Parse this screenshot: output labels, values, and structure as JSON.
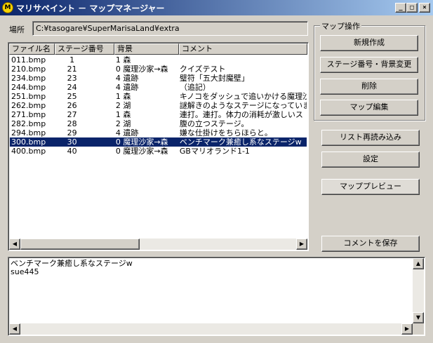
{
  "window": {
    "title": "マリサペイント － マップマネージャー",
    "icon_label": "M",
    "minimize_glyph": "_",
    "maximize_glyph": "□",
    "close_glyph": "×"
  },
  "location": {
    "label": "場所",
    "path": "C:¥tasogare¥SuperMarisaLand¥extra"
  },
  "file_list": {
    "columns": [
      "ファイル名",
      "ステージ番号",
      "背景",
      "コメント"
    ],
    "rows": [
      {
        "file": "011.bmp",
        "stage": "1",
        "bg": "1 森",
        "comment": ""
      },
      {
        "file": "210.bmp",
        "stage": "21",
        "bg": "0 魔理沙家→森",
        "comment": "クイズテスト"
      },
      {
        "file": "234.bmp",
        "stage": "23",
        "bg": "4 遺跡",
        "comment": "璧符「五大封魔壁」"
      },
      {
        "file": "244.bmp",
        "stage": "24",
        "bg": "4 遺跡",
        "comment": "（追記）"
      },
      {
        "file": "251.bmp",
        "stage": "25",
        "bg": "1 森",
        "comment": "キノコをダッシュで追いかける魔理沙"
      },
      {
        "file": "262.bmp",
        "stage": "26",
        "bg": "2 湖",
        "comment": "謎解きのようなステージになっていま"
      },
      {
        "file": "271.bmp",
        "stage": "27",
        "bg": "1 森",
        "comment": "連打。連打。体力の消耗が激しいス"
      },
      {
        "file": "282.bmp",
        "stage": "28",
        "bg": "2 湖",
        "comment": "腹の立つステージ。"
      },
      {
        "file": "294.bmp",
        "stage": "29",
        "bg": "4 遺跡",
        "comment": "嫌な仕掛けをちらほらと。"
      },
      {
        "file": "300.bmp",
        "stage": "30",
        "bg": "0 魔理沙家→森",
        "comment": "ベンチマーク兼癒し系なステージw",
        "selected": true
      },
      {
        "file": "400.bmp",
        "stage": "40",
        "bg": "0 魔理沙家→森",
        "comment": "GBマリオランド1-1"
      }
    ]
  },
  "map_ops": {
    "caption": "マップ操作",
    "new": "新規作成",
    "change": "ステージ番号・背景変更",
    "delete": "削除",
    "edit": "マップ編集"
  },
  "side_buttons": {
    "reload": "リスト再読み込み",
    "settings": "設定",
    "preview": "マッププレビュー",
    "save_comment": "コメントを保存"
  },
  "comment": {
    "lines": "ベンチマーク兼癒し系なステージw\nsue445"
  },
  "scroll": {
    "left": "◀",
    "right": "▶",
    "up": "▲",
    "down": "▼"
  }
}
